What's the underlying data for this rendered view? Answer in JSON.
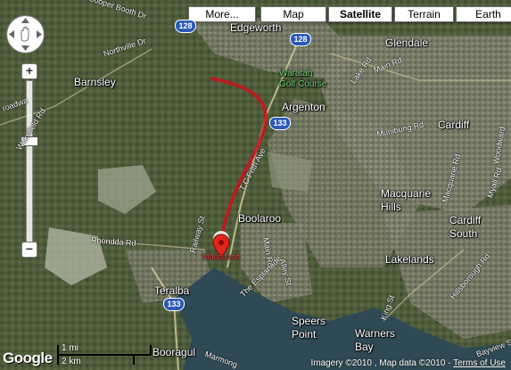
{
  "map_types": {
    "more": "More...",
    "map": "Map",
    "satellite": "Satellite",
    "terrain": "Terrain",
    "earth": "Earth",
    "active": "satellite"
  },
  "places": {
    "edgeworth": "Edgeworth",
    "glendale": "Glendale",
    "barnsley": "Barnsley",
    "argenton": "Argenton",
    "cardiff": "Cardiff",
    "macquarie_hills": "Macquarie\nHills",
    "boolaroo": "Boolaroo",
    "cardiff_south": "Cardiff\nSouth",
    "lakelands": "Lakelands",
    "teralba": "Teralba",
    "booragul": "Booragul",
    "speers_point": "Speers\nPoint",
    "warners_bay": "Warners\nBay",
    "waratah_golf": "Waratah\nGolf Course",
    "macquarie_marker_label": "Macquarie"
  },
  "roads": {
    "cooper_booth": "Cooper Booth Dr",
    "northville": "Northville Dr",
    "wakefield": "Wakefield Rd",
    "main_rd_top": "Main Rd",
    "lake_rd": "Lake Rd",
    "munibung": "Munibung Rd",
    "tc_frith": "T C Frith Ave",
    "rhondda": "Rhondda Rd",
    "railway": "Railway St",
    "main_rd": "Main Rd",
    "esplanade": "The Esplanade",
    "alley": "Alley St",
    "hillsborough": "Hillsborough Rd",
    "king": "King St",
    "myall": "Myall Rd",
    "macquarie_rd": "Macquarie Rd",
    "woodward": "Woodward",
    "marmong": "Marmong",
    "broadwa": "roadwa",
    "bayview": "Bayview St"
  },
  "shields": {
    "s128a": "128",
    "s128b": "128",
    "s133a": "133",
    "s133b": "133"
  },
  "scale": {
    "mi": "1 mi",
    "km": "2 km"
  },
  "logo": "Google",
  "attribution": {
    "text": "Imagery ©2010 , Map data ©2010 - ",
    "terms": "Terms of Use"
  },
  "colors": {
    "route": "#c8141e",
    "water": "#2f4a55",
    "shield": "#2a59b8"
  }
}
